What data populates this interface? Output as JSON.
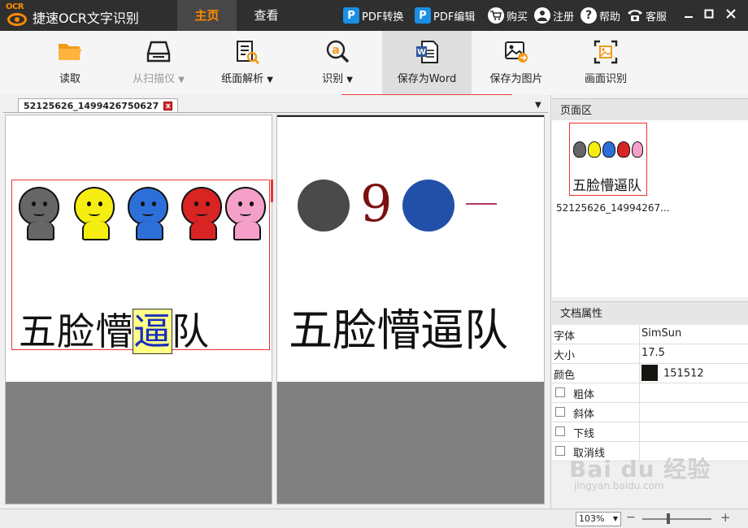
{
  "app": {
    "logo_text": "OCR",
    "title": "捷速OCR文字识别"
  },
  "nav": {
    "tabs": [
      {
        "label": "主页",
        "active": true
      },
      {
        "label": "查看",
        "active": false
      }
    ]
  },
  "top_links": {
    "pdf_convert": "PDF转换",
    "pdf_edit": "PDF编辑",
    "buy": "购买",
    "register": "注册",
    "help": "帮助",
    "service": "客服"
  },
  "toolbar": {
    "read": "读取",
    "from_scanner": "从扫描仪",
    "page_analysis": "纸面解析",
    "recognize": "识别",
    "save_word": "保存为Word",
    "save_image": "保存为图片",
    "area_recognize": "画面识别",
    "dropdown_glyph": "▼"
  },
  "document": {
    "tab_name": "52125626_1499426750627",
    "close_glyph": "x",
    "source_text_before": "五脸懵",
    "source_text_highlight": "逼",
    "source_text_after": "队",
    "result_nine": "9",
    "result_text": "五脸懵逼队"
  },
  "sidebar": {
    "page_zone_title": "页面区",
    "thumb_text": "五脸懵逼队",
    "thumb_label": "52125626_14994267...",
    "props_title": "文档属性",
    "props": {
      "font_key": "字体",
      "font_value": "SimSun",
      "size_key": "大小",
      "size_value": "17.5",
      "color_key": "颜色",
      "color_value": "151512",
      "bold": "粗体",
      "italic": "斜体",
      "underline": "下线",
      "strike": "取消线"
    }
  },
  "status": {
    "zoom": "103%",
    "minus": "−",
    "plus": "+"
  },
  "watermark": {
    "main": "Bai du 经验",
    "sub": "jingyan.baidu.com"
  },
  "colors": {
    "accent": "#ff8a00",
    "face_gray": "#666666",
    "face_yellow": "#f5ee10",
    "face_blue": "#2d6fd8",
    "face_red": "#d92424",
    "face_pink": "#f5a0c8",
    "text_color": "#151512"
  }
}
